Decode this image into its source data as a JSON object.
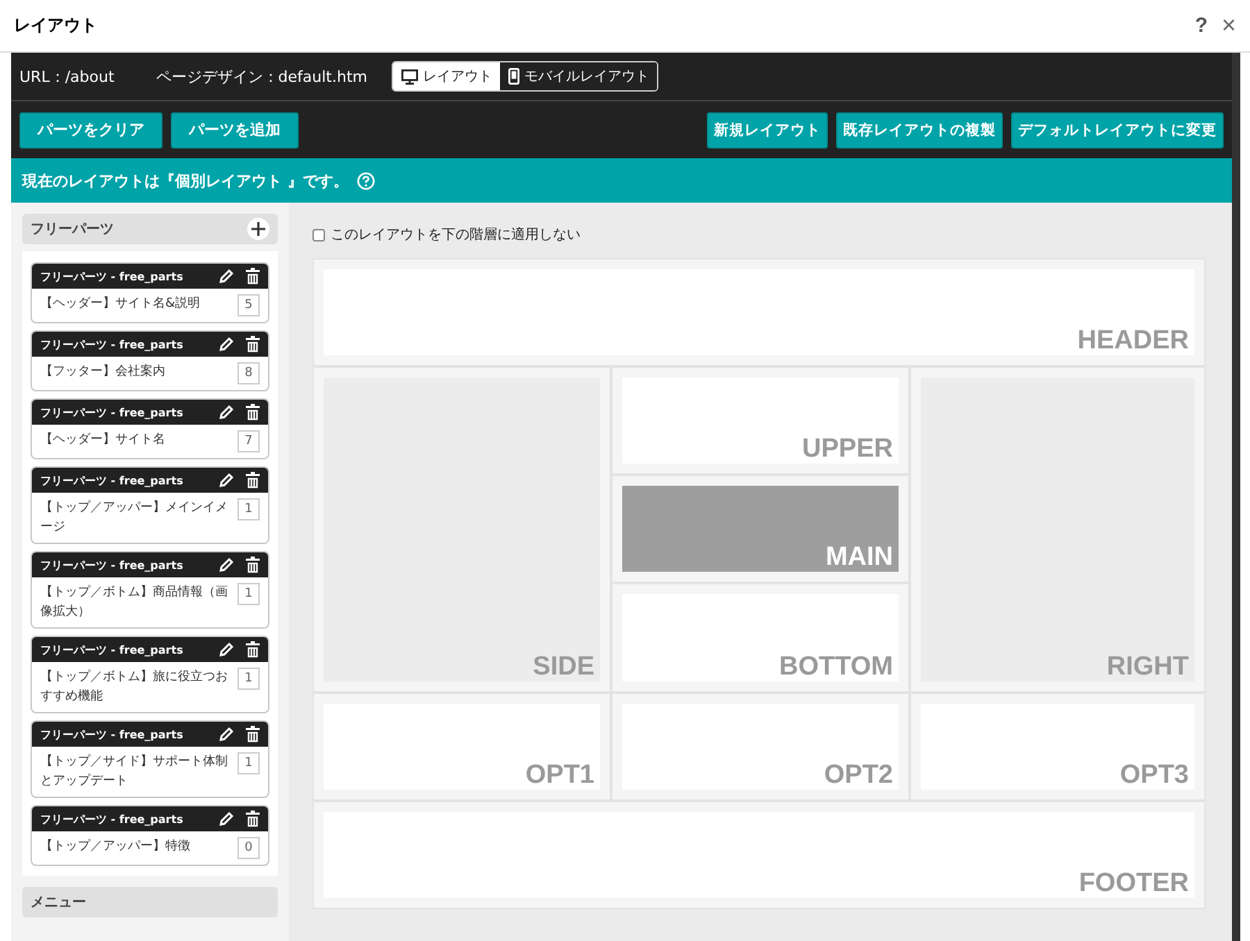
{
  "window": {
    "title": "レイアウト",
    "help": "?",
    "close": "×"
  },
  "info_bar": {
    "url": "URL：/about",
    "design": "ページデザイン：default.htm",
    "view_tabs": [
      {
        "label": "レイアウト",
        "kind": "desktop",
        "selected": true
      },
      {
        "label": "モバイルレイアウト",
        "kind": "mobile",
        "selected": false
      }
    ]
  },
  "toolbar": {
    "left_buttons": [
      "パーツをクリア",
      "パーツを追加"
    ],
    "right_buttons": [
      "新規レイアウト",
      "既存レイアウトの複製",
      "デフォルトレイアウトに変更"
    ]
  },
  "notice": "現在のレイアウトは『個別レイアウト 』です。",
  "sidebar": {
    "groups": [
      {
        "title": "フリーパーツ",
        "items": [
          {
            "title": "フリーパーツ - free_parts",
            "name": "【ヘッダー】サイト名&説明",
            "count": "5"
          },
          {
            "title": "フリーパーツ - free_parts",
            "name": "【フッター】会社案内",
            "count": "8"
          },
          {
            "title": "フリーパーツ - free_parts",
            "name": "【ヘッダー】サイト名",
            "count": "7"
          },
          {
            "title": "フリーパーツ - free_parts",
            "name": "【トップ／アッパー】メインイメージ",
            "count": "1"
          },
          {
            "title": "フリーパーツ - free_parts",
            "name": "【トップ／ボトム】商品情報（画像拡大）",
            "count": "1"
          },
          {
            "title": "フリーパーツ - free_parts",
            "name": "【トップ／ボトム】旅に役立つおすすめ機能",
            "count": "1"
          },
          {
            "title": "フリーパーツ - free_parts",
            "name": "【トップ／サイド】サポート体制とアップデート",
            "count": "1"
          },
          {
            "title": "フリーパーツ - free_parts",
            "name": "【トップ／アッパー】特徴",
            "count": "0"
          }
        ]
      },
      {
        "title": "メニュー"
      }
    ]
  },
  "layout": {
    "option": {
      "label": "このレイアウトを下の階層に適用しない",
      "checked": false
    },
    "zones": [
      {
        "label": "HEADER",
        "kind": "blank"
      },
      {
        "label": "SIDE",
        "kind": "column"
      },
      {
        "label": "UPPER",
        "kind": "blank"
      },
      {
        "label": "MAIN",
        "kind": "main"
      },
      {
        "label": "BOTTOM",
        "kind": "blank"
      },
      {
        "label": "RIGHT",
        "kind": "column"
      },
      {
        "label": "OPT1",
        "kind": "blank"
      },
      {
        "label": "OPT2",
        "kind": "blank"
      },
      {
        "label": "OPT3",
        "kind": "blank"
      },
      {
        "label": "FOOTER",
        "kind": "blank"
      }
    ]
  }
}
